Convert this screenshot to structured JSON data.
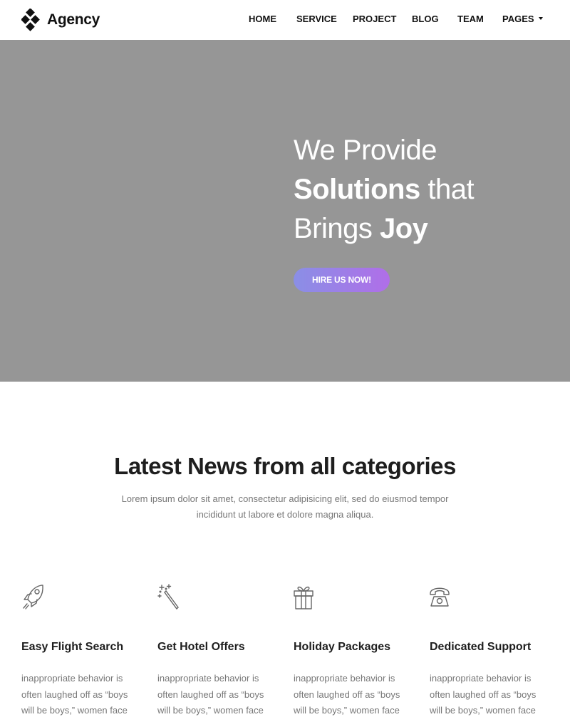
{
  "header": {
    "brand": "Agency",
    "logo_icon": "diamond-cluster-icon",
    "nav": [
      {
        "label": "HOME"
      },
      {
        "label": "SERVICE"
      },
      {
        "label": "PROJECT"
      },
      {
        "label": "BLOG"
      },
      {
        "label": "TEAM"
      },
      {
        "label": "PAGES",
        "has_dropdown": true
      }
    ]
  },
  "hero": {
    "line1": "We Provide",
    "line2_bold": "Solutions",
    "line2_rest": " that",
    "line3_pre": "Brings ",
    "line3_bold": "Joy",
    "cta_label": "HIRE US NOW!",
    "background_color": "#969696",
    "cta_gradient": [
      "#8a8fe6",
      "#b06ee8"
    ]
  },
  "news": {
    "title": "Latest News from all categories",
    "description": "Lorem ipsum dolor sit amet, consectetur adipisicing elit, sed do eiusmod tempor incididunt ut labore et dolore magna aliqua."
  },
  "features": [
    {
      "icon": "rocket-icon",
      "title": "Easy Flight Search",
      "text": "inappropriate behavior is often laughed off as “boys will be boys,” women face higher"
    },
    {
      "icon": "magic-wand-icon",
      "title": "Get Hotel Offers",
      "text": "inappropriate behavior is often laughed off as “boys will be boys,” women face higher"
    },
    {
      "icon": "gift-icon",
      "title": "Holiday Packages",
      "text": "inappropriate behavior is often laughed off as “boys will be boys,” women face higher"
    },
    {
      "icon": "telephone-icon",
      "title": "Dedicated Support",
      "text": "inappropriate behavior is often laughed off as “boys will be boys,” women face higher"
    }
  ]
}
